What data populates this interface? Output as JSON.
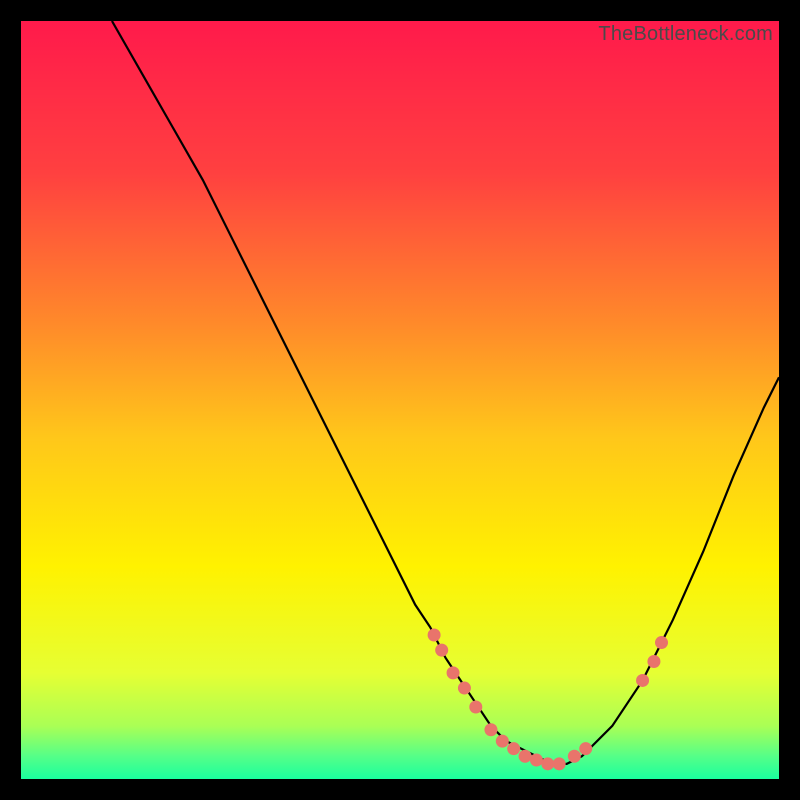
{
  "watermark": "TheBottleneck.com",
  "chart_data": {
    "type": "line",
    "title": "",
    "xlabel": "",
    "ylabel": "",
    "xlim": [
      0,
      100
    ],
    "ylim": [
      0,
      100
    ],
    "curve": {
      "name": "bottleneck-curve",
      "x": [
        12,
        16,
        20,
        24,
        28,
        32,
        36,
        40,
        44,
        48,
        52,
        54,
        56,
        58,
        60,
        62,
        64,
        66,
        68,
        70,
        72,
        74,
        78,
        82,
        86,
        90,
        94,
        98,
        100
      ],
      "y": [
        100,
        93,
        86,
        79,
        71,
        63,
        55,
        47,
        39,
        31,
        23,
        20,
        16,
        13,
        10,
        7,
        5,
        4,
        3,
        2,
        2,
        3,
        7,
        13,
        21,
        30,
        40,
        49,
        53
      ]
    },
    "points": {
      "name": "benchmark-points",
      "x": [
        54.5,
        55.5,
        57.0,
        58.5,
        60.0,
        62.0,
        63.5,
        65.0,
        66.5,
        68.0,
        69.5,
        71.0,
        73.0,
        74.5,
        82.0,
        83.5,
        84.5
      ],
      "y": [
        19.0,
        17.0,
        14.0,
        12.0,
        9.5,
        6.5,
        5.0,
        4.0,
        3.0,
        2.5,
        2.0,
        2.0,
        3.0,
        4.0,
        13.0,
        15.5,
        18.0
      ]
    },
    "gradient_stops": [
      {
        "offset": 0.0,
        "color": "#ff1a4b"
      },
      {
        "offset": 0.2,
        "color": "#ff4040"
      },
      {
        "offset": 0.4,
        "color": "#ff8a2a"
      },
      {
        "offset": 0.55,
        "color": "#ffc71a"
      },
      {
        "offset": 0.72,
        "color": "#fff200"
      },
      {
        "offset": 0.86,
        "color": "#e6ff33"
      },
      {
        "offset": 0.93,
        "color": "#aaff55"
      },
      {
        "offset": 0.97,
        "color": "#55ff88"
      },
      {
        "offset": 1.0,
        "color": "#1aff9e"
      }
    ],
    "point_color": "#e9746b",
    "curve_color": "#000000"
  }
}
